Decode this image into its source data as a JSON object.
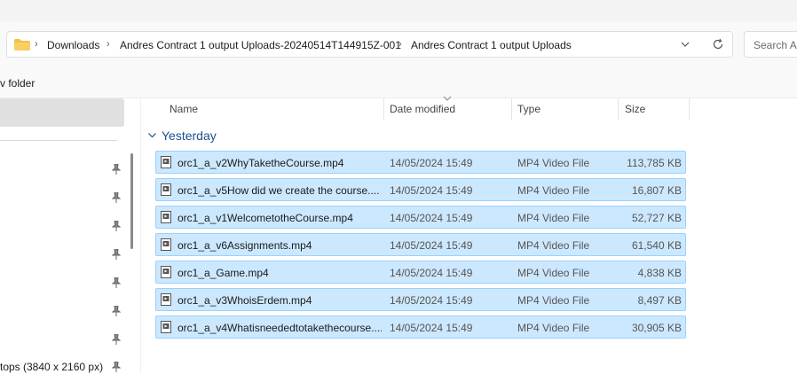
{
  "breadcrumbs": [
    "Downloads",
    "Andres Contract 1 output Uploads-20240514T144915Z-001",
    "Andres Contract 1 output Uploads"
  ],
  "search": {
    "placeholder": "Search Ar"
  },
  "toolbar": {
    "new_folder_label": "v folder"
  },
  "nav": {
    "item_tops": "tops (3840 x 2160 px)"
  },
  "columns": {
    "name": "Name",
    "date": "Date modified",
    "type": "Type",
    "size": "Size"
  },
  "group": {
    "label": "Yesterday"
  },
  "files": [
    {
      "name": "orc1_a_v2WhyTaketheCourse.mp4",
      "date": "14/05/2024 15:49",
      "type": "MP4 Video File",
      "size": "113,785 KB"
    },
    {
      "name": "orc1_a_v5How did we create the course....",
      "date": "14/05/2024 15:49",
      "type": "MP4 Video File",
      "size": "16,807 KB"
    },
    {
      "name": "orc1_a_v1WelcometotheCourse.mp4",
      "date": "14/05/2024 15:49",
      "type": "MP4 Video File",
      "size": "52,727 KB"
    },
    {
      "name": "orc1_a_v6Assignments.mp4",
      "date": "14/05/2024 15:49",
      "type": "MP4 Video File",
      "size": "61,540 KB"
    },
    {
      "name": "orc1_a_Game.mp4",
      "date": "14/05/2024 15:49",
      "type": "MP4 Video File",
      "size": "4,838 KB"
    },
    {
      "name": "orc1_a_v3WhoisErdem.mp4",
      "date": "14/05/2024 15:49",
      "type": "MP4 Video File",
      "size": "8,497 KB"
    },
    {
      "name": "orc1_a_v4Whatisneededtotakethecourse....",
      "date": "14/05/2024 15:49",
      "type": "MP4 Video File",
      "size": "30,905 KB"
    }
  ],
  "colors": {
    "selection_bg": "#cce8ff",
    "selection_border": "#99d1ff",
    "folder": "#f4c242",
    "group_label": "#1f4e8c"
  },
  "icons": {
    "folder": "folder-icon",
    "file": "video-file-icon",
    "refresh": "refresh-icon",
    "chevron": "chevron-down-icon",
    "pin": "pin-icon"
  }
}
